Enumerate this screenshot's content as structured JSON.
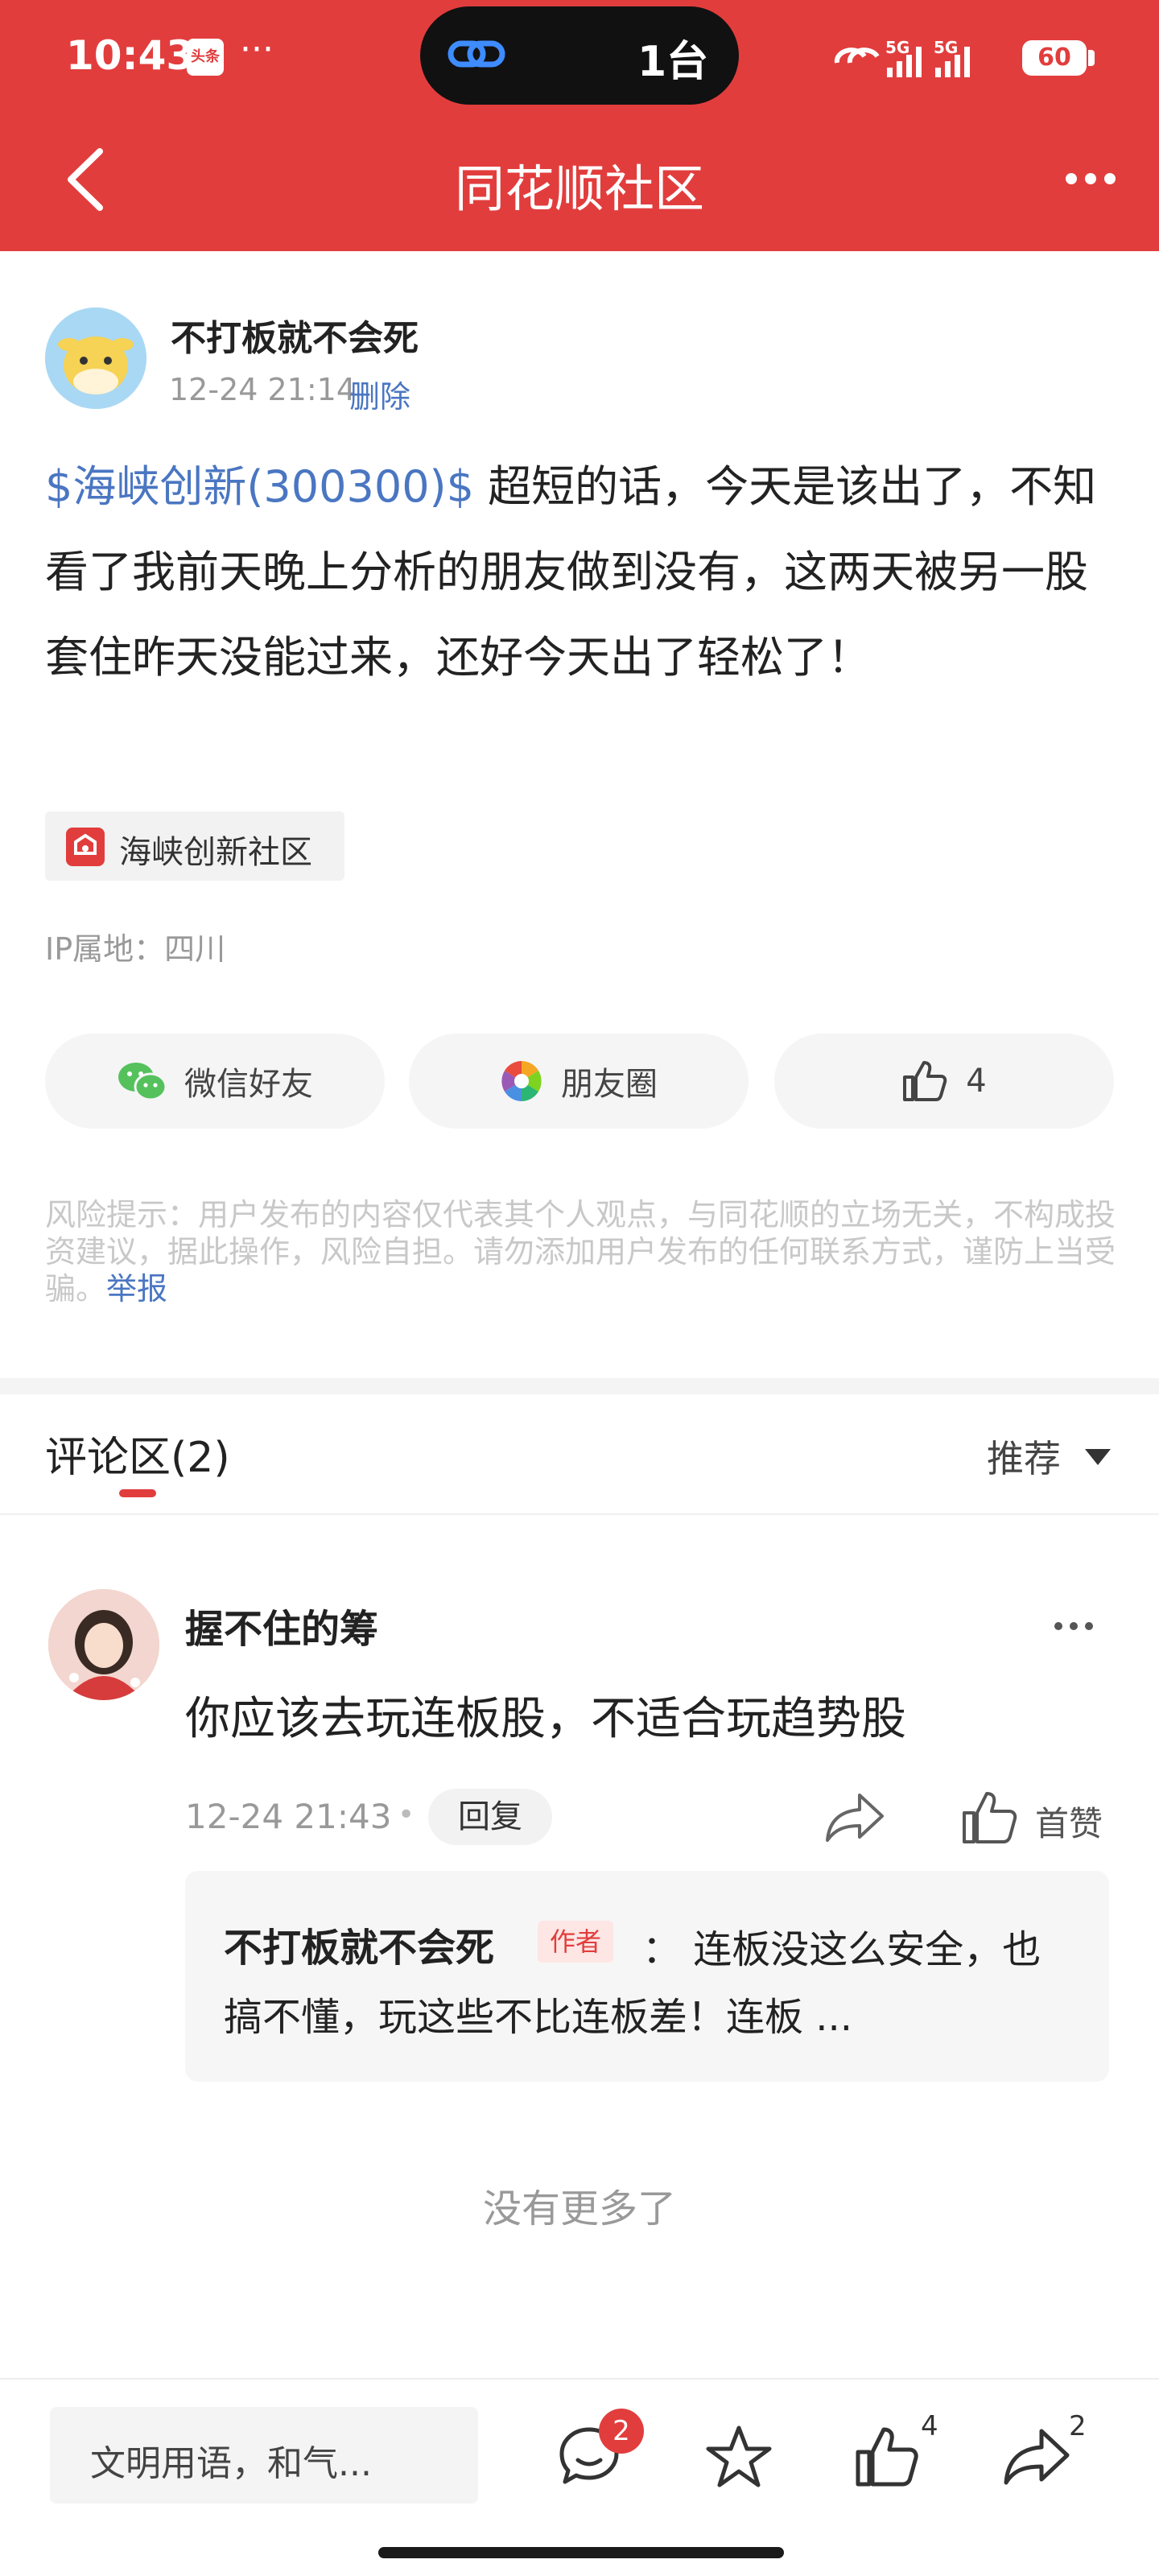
{
  "status_bar": {
    "time": "10:43",
    "app_badge": "头条",
    "dots": "···",
    "island_text": "1台",
    "network": "5G 5G",
    "battery": "60"
  },
  "header": {
    "title": "同花顺社区"
  },
  "post": {
    "author": "不打板就不会死",
    "time": "12-24 21:14",
    "delete_label": "删除",
    "stock_link": "$海峡创新(300300)$",
    "body_text": " 超短的话，今天是该出了，不知看了我前天晚上分析的朋友做到没有，这两天被另一股套住昨天没能过来，还好今天出了轻松了！",
    "community_label": "海峡创新社区",
    "ip_location": "IP属地：四川"
  },
  "share": {
    "wechat_label": "微信好友",
    "moments_label": "朋友圈",
    "like_count": "4"
  },
  "risk": {
    "text": "风险提示：用户发布的内容仅代表其个人观点，与同花顺的立场无关，不构成投资建议，据此操作，风险自担。请勿添加用户发布的任何联系方式，谨防上当受骗。",
    "report_label": "举报"
  },
  "comments": {
    "title": "评论区(2)",
    "sort_label": "推荐",
    "items": [
      {
        "author": "握不住的筹",
        "text": "你应该去玩连板股，不适合玩趋势股",
        "time": "12-24 21:43",
        "dot": "•",
        "reply_label": "回复",
        "like_label": "首赞",
        "reply": {
          "author": "不打板就不会死",
          "author_tag": "作者",
          "text": "：  连板没这么安全，也搞不懂，玩这些不比连板差！连板 ..."
        }
      }
    ],
    "no_more": "没有更多了"
  },
  "bottom_bar": {
    "input_placeholder": "文明用语，和气...",
    "comment_count": "2",
    "like_count": "4",
    "share_count": "2"
  },
  "colors": {
    "brand_red": "#e23d3d",
    "link_blue": "#4a76c2"
  }
}
